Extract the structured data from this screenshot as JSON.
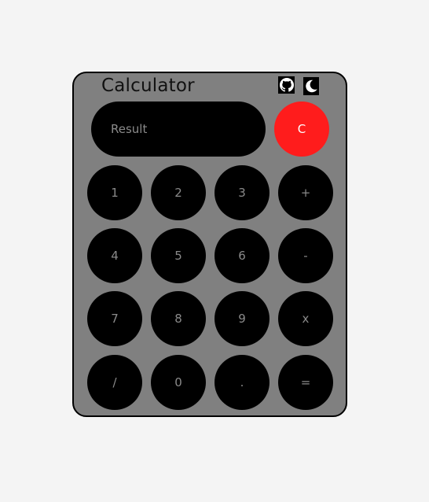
{
  "app": {
    "title": "Calculator"
  },
  "header": {
    "icons": [
      "github-icon",
      "moon-icon"
    ]
  },
  "display": {
    "placeholder": "Result"
  },
  "clear": {
    "label": "C",
    "color": "#ff1c1c"
  },
  "keys": {
    "row1": [
      "1",
      "2",
      "3",
      "+"
    ],
    "row2": [
      "4",
      "5",
      "6",
      "-"
    ],
    "row3": [
      "7",
      "8",
      "9",
      "x"
    ],
    "row4": [
      "/",
      "0",
      ".",
      "="
    ]
  },
  "colors": {
    "page_bg": "#f4f4f4",
    "panel_bg": "#808080",
    "key_bg": "#000000",
    "key_text": "#8a8a8a"
  }
}
